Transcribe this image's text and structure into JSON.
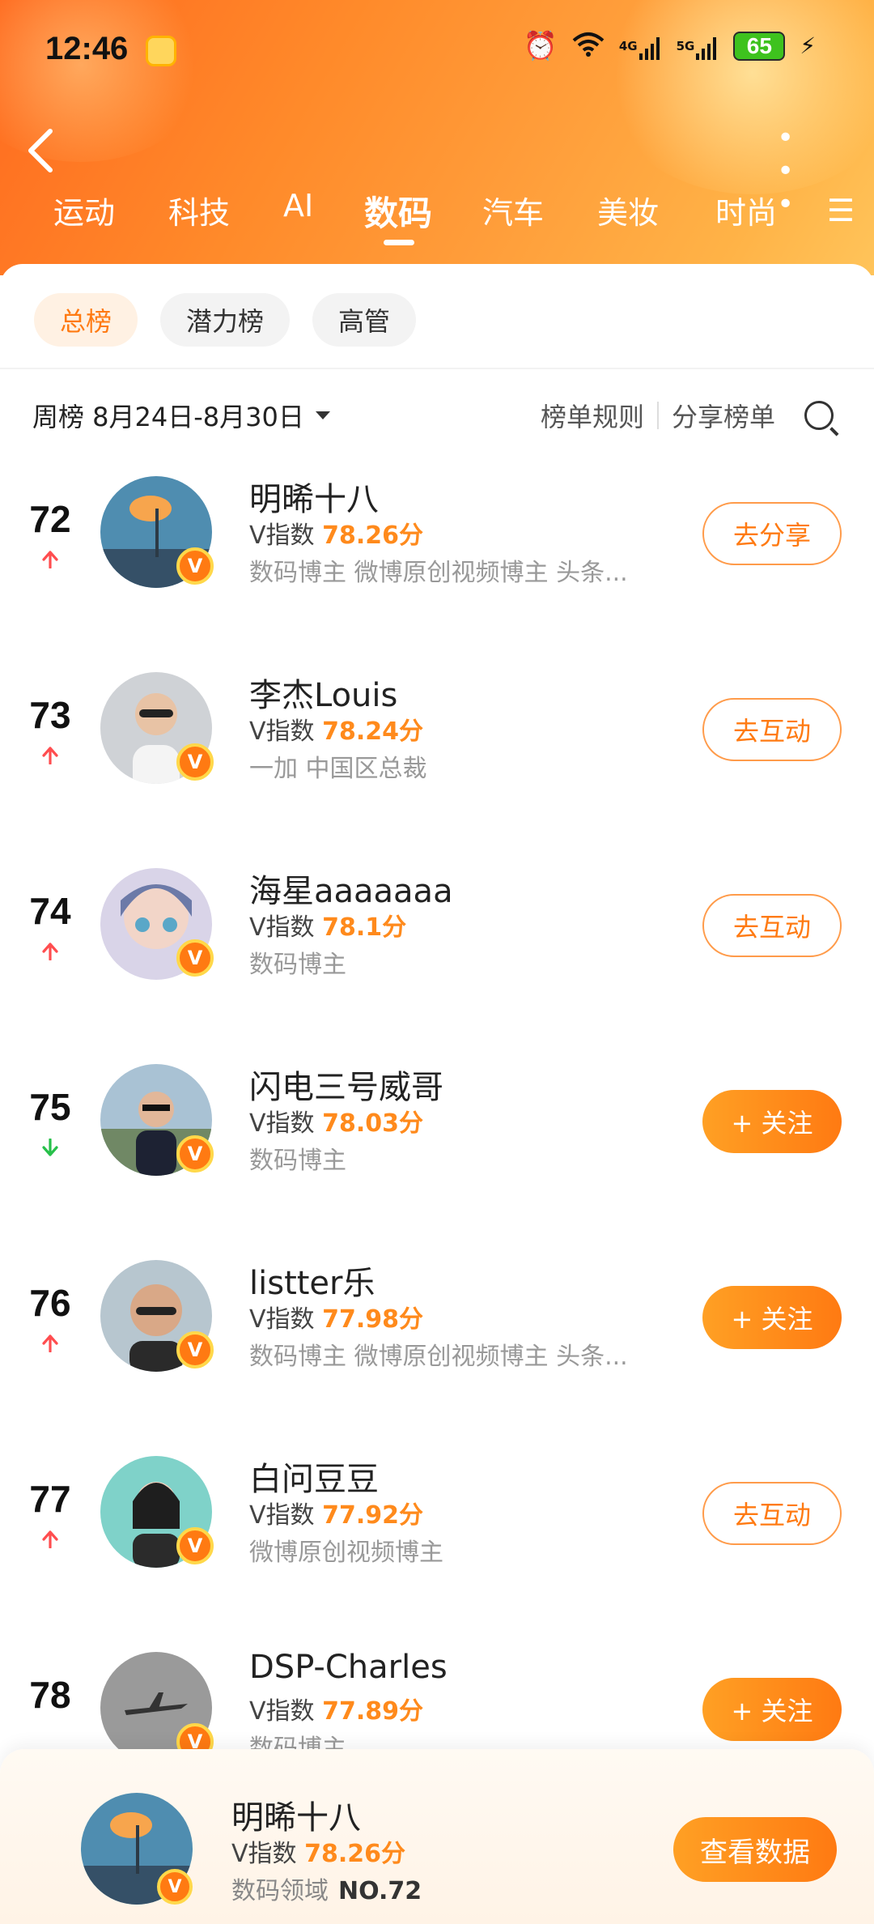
{
  "status_bar": {
    "time": "12:46",
    "net4g": "4G",
    "net5g": "5G",
    "battery": "65"
  },
  "nav": {
    "back_label": "‹",
    "more_label": "• • •"
  },
  "tabs": [
    {
      "label": "运动"
    },
    {
      "label": "科技"
    },
    {
      "label": "AI"
    },
    {
      "label": "数码"
    },
    {
      "label": "汽车"
    },
    {
      "label": "美妆"
    },
    {
      "label": "时尚"
    }
  ],
  "chips": [
    {
      "label": "总榜"
    },
    {
      "label": "潜力榜"
    },
    {
      "label": "高管"
    }
  ],
  "filter": {
    "period": "周榜 8月24日-8月30日",
    "rules": "榜单规则",
    "share": "分享榜单"
  },
  "rank_list": [
    {
      "rank": "72",
      "trend": "up",
      "name": "明晞十八",
      "v_prefix": "V指数",
      "score": "78.26分",
      "desc": "数码博主 微博原创视频博主 头条...",
      "action": "去分享",
      "action_style": "outline"
    },
    {
      "rank": "73",
      "trend": "up",
      "name": "李杰Louis",
      "v_prefix": "V指数",
      "score": "78.24分",
      "desc": "一加 中国区总裁",
      "action": "去互动",
      "action_style": "outline"
    },
    {
      "rank": "74",
      "trend": "up",
      "name": "海星aaaaaaa",
      "v_prefix": "V指数",
      "score": "78.1分",
      "desc": "数码博主",
      "action": "去互动",
      "action_style": "outline"
    },
    {
      "rank": "75",
      "trend": "down",
      "name": "闪电三号威哥",
      "v_prefix": "V指数",
      "score": "78.03分",
      "desc": "数码博主",
      "action": "+ 关注",
      "action_style": "solid"
    },
    {
      "rank": "76",
      "trend": "up",
      "name": "listter乐",
      "v_prefix": "V指数",
      "score": "77.98分",
      "desc": "数码博主 微博原创视频博主 头条...",
      "action": "+ 关注",
      "action_style": "solid"
    },
    {
      "rank": "77",
      "trend": "up",
      "name": "白问豆豆",
      "v_prefix": "V指数",
      "score": "77.92分",
      "desc": "微博原创视频博主",
      "action": "去互动",
      "action_style": "outline"
    },
    {
      "rank": "78",
      "trend": "none",
      "name": "DSP-Charles",
      "v_prefix": "V指数",
      "score": "77.89分",
      "desc": "数码博主",
      "action": "+ 关注",
      "action_style": "solid"
    }
  ],
  "badge_letter": "V",
  "bottom_card": {
    "name": "明晞十八",
    "v_prefix": "V指数",
    "score": "78.26分",
    "domain": "数码领域",
    "rank": "NO.72",
    "button": "查看数据"
  }
}
